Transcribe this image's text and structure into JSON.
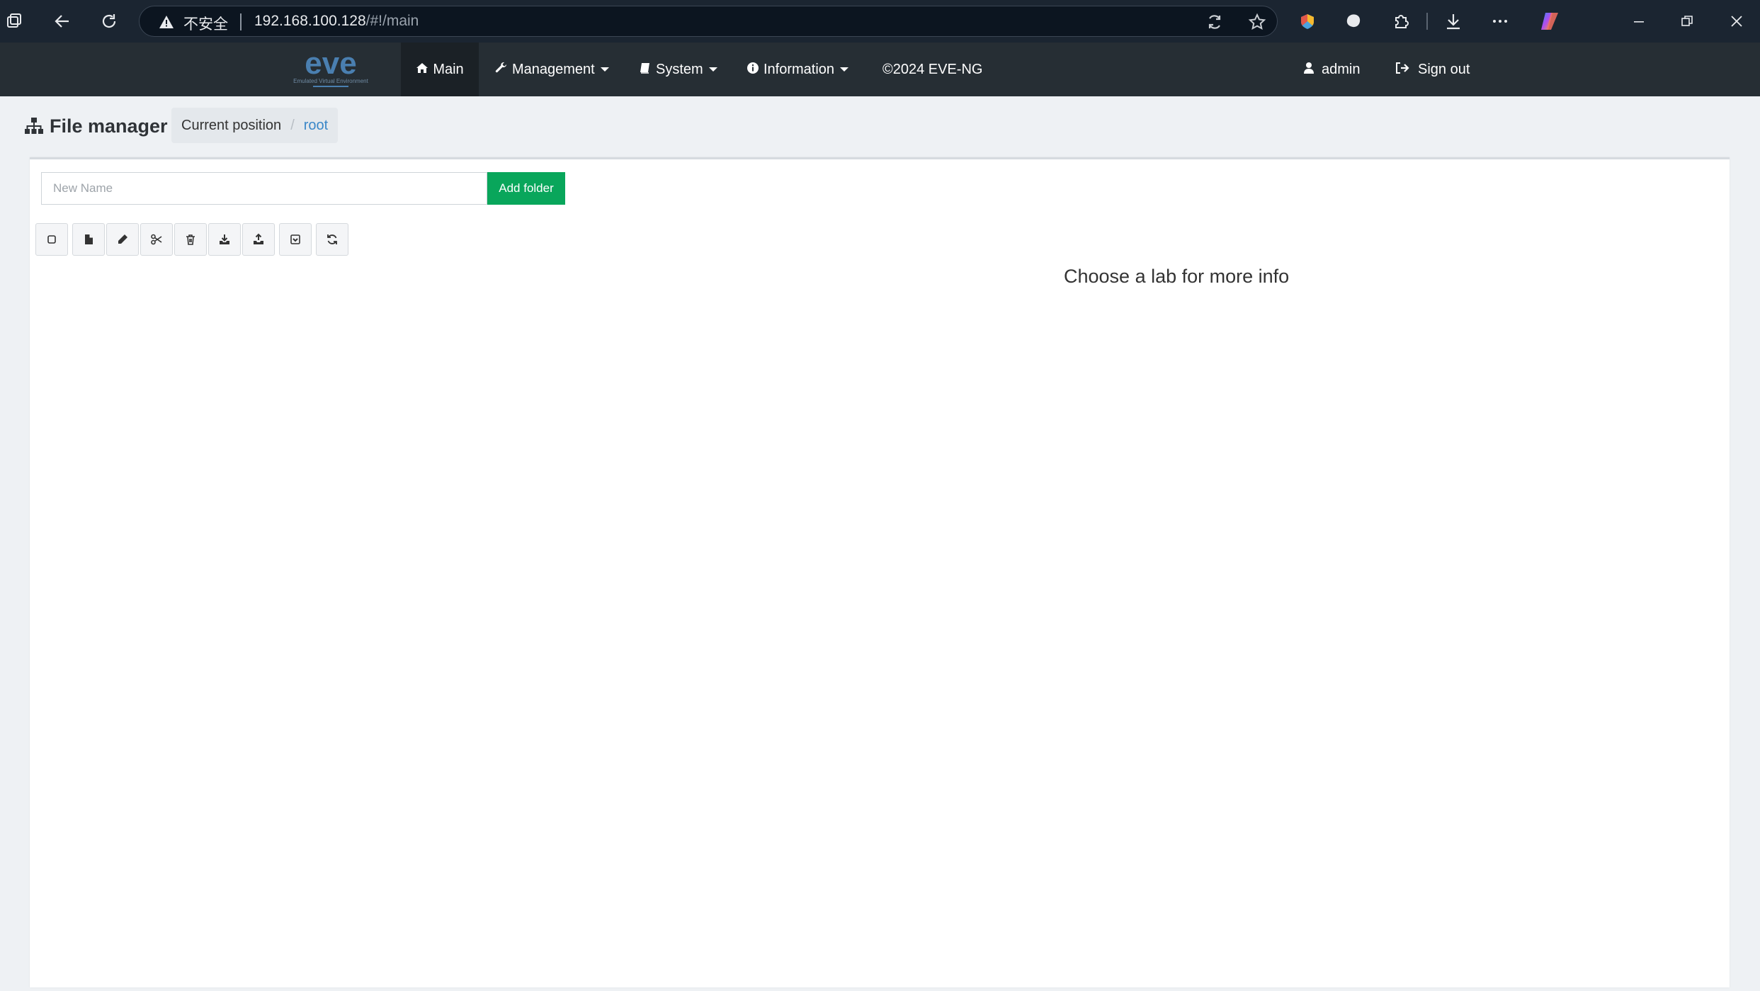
{
  "browser": {
    "security_label": "不安全",
    "url_host": "192.168.100.128",
    "url_path": "/#!/main",
    "icons": [
      "workspaces-icon",
      "back-icon",
      "reload-icon",
      "warning-icon",
      "translate-icon",
      "favorite-star-icon",
      "extension-color-icon",
      "extension-blob-icon",
      "extensions-puzzle-icon",
      "downloads-icon",
      "more-icon",
      "copilot-icon",
      "minimize-icon",
      "restore-icon",
      "close-icon"
    ]
  },
  "navbar": {
    "logo_text": "eve",
    "logo_subtext": "Emulated Virtual Environment",
    "main": "Main",
    "management": "Management",
    "system": "System",
    "information": "Information",
    "copyright": "©2024 EVE-NG",
    "user": "admin",
    "signout": "Sign out"
  },
  "page": {
    "title": "File manager",
    "breadcrumb_label": "Current position",
    "breadcrumb_sep": "/",
    "breadcrumb_current": "root"
  },
  "panel": {
    "new_name_placeholder": "New Name",
    "add_folder_label": "Add folder",
    "toolbar_icons": [
      "select-all-icon",
      "new-file-icon",
      "rename-pencil-icon",
      "cut-scissors-icon",
      "delete-trash-icon",
      "import-icon",
      "export-icon",
      "archive-icon",
      "refresh-icon"
    ],
    "info_text": "Choose a lab for more info"
  },
  "colors": {
    "chrome_bg": "#1b2531",
    "navbar_bg": "#262e34",
    "accent_green": "#09a65b",
    "link_blue": "#3a87c8",
    "page_bg": "#eef1f4"
  }
}
